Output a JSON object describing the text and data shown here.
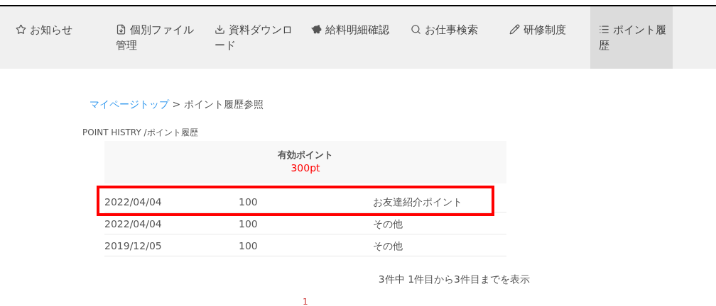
{
  "nav": [
    {
      "label": "お知らせ",
      "kind": "star",
      "selected": false
    },
    {
      "label": "個別ファイル管理",
      "kind": "file",
      "selected": false
    },
    {
      "label": "資料ダウンロード",
      "kind": "download",
      "selected": false
    },
    {
      "label": "給料明細確認",
      "kind": "piggy",
      "selected": false
    },
    {
      "label": "お仕事検索",
      "kind": "search",
      "selected": false
    },
    {
      "label": "研修制度",
      "kind": "pencil",
      "selected": false
    },
    {
      "label": "ポイント履歴",
      "kind": "list",
      "selected": true
    }
  ],
  "breadcrumb": {
    "link": "マイページトップ",
    "separator": ">",
    "current": "ポイント履歴参照"
  },
  "section_title": "POINT HISTRY /ポイント履歴",
  "summary": {
    "label": "有効ポイント",
    "value": "300pt"
  },
  "rows": [
    {
      "date": "2022/04/04",
      "points": "100",
      "reason": "お友達紹介ポイント",
      "highlighted": true
    },
    {
      "date": "2022/04/04",
      "points": "100",
      "reason": "その他",
      "highlighted": false
    },
    {
      "date": "2019/12/05",
      "points": "100",
      "reason": "その他",
      "highlighted": false
    }
  ],
  "count_text": "3件中 1件目から3件目までを表示",
  "pages": [
    {
      "label": "1",
      "selected": true
    }
  ]
}
